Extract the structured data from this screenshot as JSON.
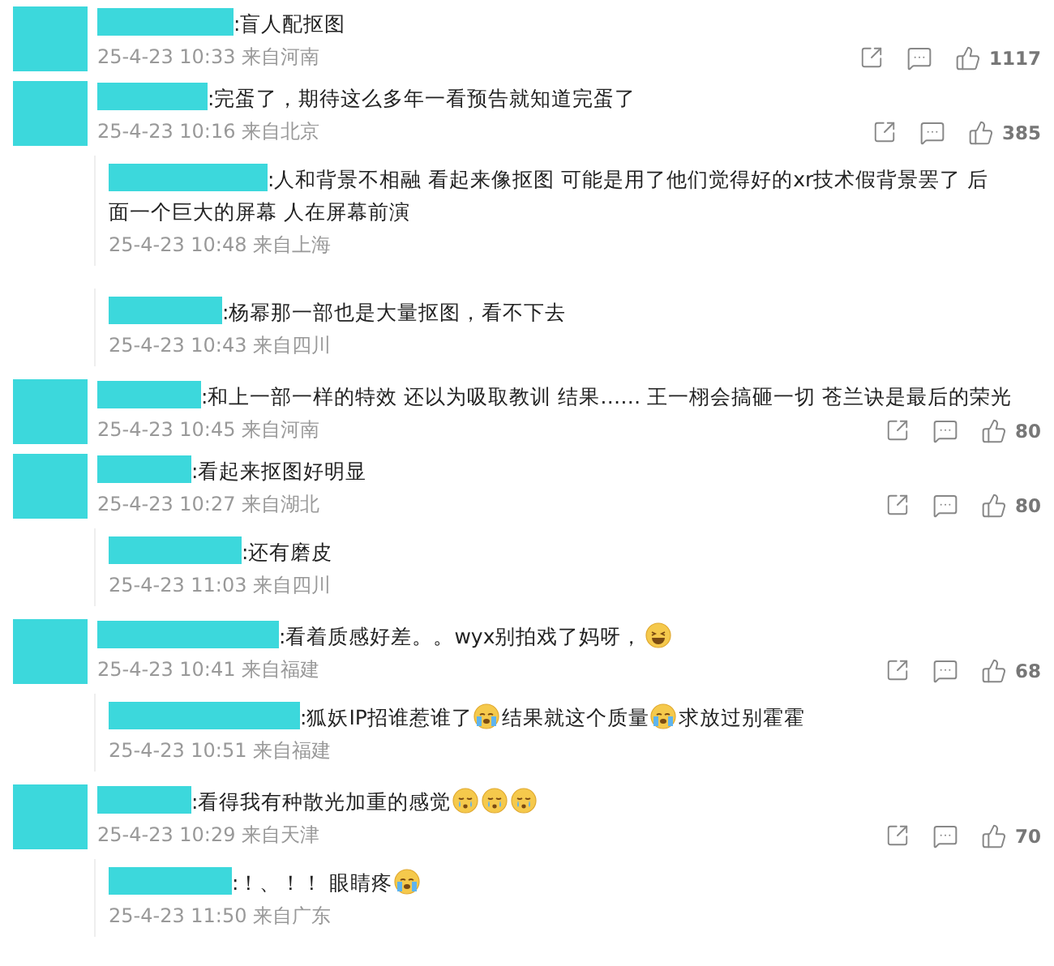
{
  "comments": [
    {
      "text": [
        {
          "kind": "text",
          "text": ":盲人配抠图"
        }
      ],
      "time": "25-4-23 10:33 来自河南",
      "likes": "1117"
    },
    {
      "text": [
        {
          "kind": "text",
          "text": ":完蛋了，期待这么多年一看预告就知道完蛋了"
        }
      ],
      "time": "25-4-23 10:16 来自北京",
      "likes": "385",
      "replies": [
        {
          "text": [
            {
              "kind": "text",
              "text": ":人和背景不相融 看起来像抠图 可能是用了他们觉得好的xr技术假背景罢了 后"
            },
            {
              "kind": "line",
              "text": "面一个巨大的屏幕 人在屏幕前演"
            }
          ],
          "time": "25-4-23 10:48 来自上海"
        },
        {
          "text": [
            {
              "kind": "text",
              "text": ":杨幂那一部也是大量抠图，看不下去"
            }
          ],
          "time": "25-4-23 10:43 来自四川"
        }
      ]
    },
    {
      "text": [
        {
          "kind": "text",
          "text": ":和上一部一样的特效 还以为吸取教训 结果…… 王一栩会搞砸一切 苍兰诀是最后的荣光"
        }
      ],
      "time": "25-4-23 10:45 来自河南",
      "likes": "80"
    },
    {
      "text": [
        {
          "kind": "text",
          "text": ":看起来抠图好明显"
        }
      ],
      "time": "25-4-23 10:27 来自湖北",
      "likes": "80",
      "replies": [
        {
          "text": [
            {
              "kind": "text",
              "text": ":还有磨皮"
            }
          ],
          "time": "25-4-23 11:03 来自四川"
        }
      ]
    },
    {
      "text": [
        {
          "kind": "text",
          "text": ":看着质感好差。。wyx别拍戏了妈呀，"
        },
        {
          "kind": "laugh"
        }
      ],
      "time": "25-4-23 10:41 来自福建",
      "likes": "68",
      "replies": [
        {
          "text": [
            {
              "kind": "text",
              "text": ":狐妖IP招谁惹谁了"
            },
            {
              "kind": "sob"
            },
            {
              "kind": "text",
              "text": "结果就这个质量"
            },
            {
              "kind": "sob"
            },
            {
              "kind": "text",
              "text": "求放过别霍霍"
            }
          ],
          "time": "25-4-23 10:51 来自福建"
        }
      ]
    },
    {
      "text": [
        {
          "kind": "text",
          "text": ":看得我有种散光加重的感觉"
        },
        {
          "kind": "cry"
        },
        {
          "kind": "cry"
        },
        {
          "kind": "cry"
        }
      ],
      "time": "25-4-23 10:29 来自天津",
      "likes": "70",
      "replies": [
        {
          "text": [
            {
              "kind": "text",
              "text": ":！、！！ 眼睛疼"
            },
            {
              "kind": "sob"
            }
          ],
          "time": "25-4-23 11:50 来自广东"
        }
      ]
    }
  ]
}
